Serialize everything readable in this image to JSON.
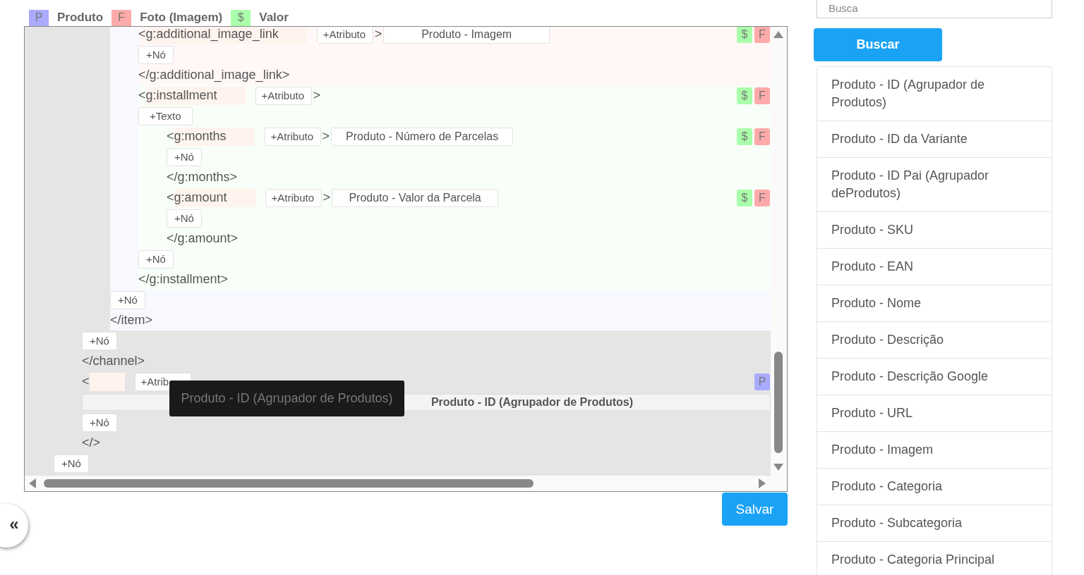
{
  "legend": [
    {
      "label": "P",
      "color": "#aaaaff",
      "text": "Produto"
    },
    {
      "label": "F",
      "color": "#ffaaaa",
      "text": "Foto (Imagem)"
    },
    {
      "label": "$",
      "color": "#aaffaa",
      "text": "Valor"
    }
  ],
  "editor": {
    "tree": {
      "node_button": "+Nó",
      "children": [
        {
          "node_button": "+Nó",
          "close": "</channel>",
          "children": [
            {
              "color": "#f8f8ff",
              "node_button": "+Nó",
              "close": "</item>",
              "children": [
                {
                  "color": "#fff8f6",
                  "open": "<",
                  "name": "g:additional_image_link",
                  "attr_button": "+Atributo",
                  "gt": ">",
                  "value": "Produto - Imagem",
                  "kind": "inline",
                  "badges": [
                    {
                      "label": "$",
                      "color": "#aaffaa"
                    },
                    {
                      "label": "F",
                      "color": "#ffaaaa"
                    }
                  ],
                  "node_button": "+Nó",
                  "close": "</g:additional_image_link>"
                },
                {
                  "color": "#f8fff8",
                  "open": "<",
                  "name": "g:installment",
                  "attr_button": "+Atributo",
                  "gt": ">",
                  "badges": [
                    {
                      "label": "$",
                      "color": "#aaffaa"
                    },
                    {
                      "label": "F",
                      "color": "#ffaaaa"
                    }
                  ],
                  "text_button": "+Texto",
                  "node_button": "+Nó",
                  "close": "</g:installment>",
                  "children": [
                    {
                      "open": "<",
                      "name": "g:months",
                      "attr_button": "+Atributo",
                      "gt": ">",
                      "value": "Produto - Número de Parcelas",
                      "kind": "inline",
                      "badges": [
                        {
                          "label": "$",
                          "color": "#aaffaa"
                        },
                        {
                          "label": "F",
                          "color": "#ffaaaa"
                        }
                      ],
                      "node_button": "+Nó",
                      "close": "</g:months>"
                    },
                    {
                      "open": "<",
                      "name": "g:amount",
                      "attr_button": "+Atributo",
                      "gt": ">",
                      "value": "Produto - Valor da Parcela",
                      "kind": "inline",
                      "badges": [
                        {
                          "label": "$",
                          "color": "#aaffaa"
                        },
                        {
                          "label": "F",
                          "color": "#ffaaaa"
                        }
                      ],
                      "node_button": "+Nó",
                      "close": "</g:amount>"
                    }
                  ]
                }
              ]
            }
          ]
        },
        {
          "open": "<",
          "attr_button": "+Atrib",
          "value": "Produto - ID (Agrupador de Produtos)",
          "kind": "block",
          "badges": [
            {
              "label": "P",
              "color": "#aaaaff"
            }
          ],
          "node_button": "+Nó",
          "close": "</>"
        }
      ]
    },
    "tooltip": "Produto - ID (Agrupador de Produtos)"
  },
  "save_button": "Salvar",
  "collapse_button": "«",
  "sidebar": {
    "search": {
      "placeholder": "Busca"
    },
    "search_button": "Buscar",
    "items": [
      "Produto - ID (Agrupador de Produtos)",
      "Produto - ID da Variante",
      "Produto - ID Pai (Agrupador deProdutos)",
      "Produto - SKU",
      "Produto - EAN",
      "Produto - Nome",
      "Produto - Descrição",
      "Produto - Descrição Google",
      "Produto - URL",
      "Produto - Imagem",
      "Produto - Categoria",
      "Produto - Subcategoria",
      "Produto - Categoria Principal"
    ]
  }
}
